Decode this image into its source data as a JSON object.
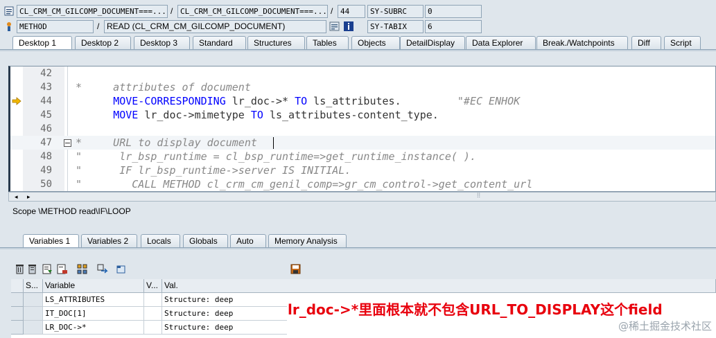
{
  "header": {
    "program_field": "CL_CRM_CM_GILCOMP_DOCUMENT===...",
    "include_field": "CL_CRM_CM_GILCOMP_DOCUMENT===...",
    "line_number": "44",
    "subrc_label": "SY-SUBRC",
    "subrc_value": "0",
    "event_type": "METHOD",
    "event_name": "READ (CL_CRM_CM_GILCOMP_DOCUMENT)",
    "tabix_label": "SY-TABIX",
    "tabix_value": "6",
    "separator": "/"
  },
  "tabs": [
    "Desktop 1",
    "Desktop 2",
    "Desktop 3",
    "Standard",
    "Structures",
    "Tables",
    "Objects",
    "DetailDisplay",
    "Data Explorer",
    "Break./Watchpoints",
    "Diff",
    "Script"
  ],
  "editor": {
    "lines": [
      {
        "num": "42",
        "segments": []
      },
      {
        "num": "43",
        "segments": [
          {
            "t": "*     attributes of document",
            "c": "cm"
          }
        ]
      },
      {
        "num": "44",
        "segments": [
          {
            "t": "      ",
            "c": ""
          },
          {
            "t": "MOVE-CORRESPONDING",
            "c": "kw"
          },
          {
            "t": " lr_doc->* ",
            "c": ""
          },
          {
            "t": "TO",
            "c": "kw"
          },
          {
            "t": " ls_attributes.         ",
            "c": ""
          },
          {
            "t": "\"#EC ENHOK",
            "c": "cm"
          }
        ]
      },
      {
        "num": "45",
        "segments": [
          {
            "t": "      ",
            "c": ""
          },
          {
            "t": "MOVE",
            "c": "kw"
          },
          {
            "t": " lr_doc->mimetype ",
            "c": ""
          },
          {
            "t": "TO",
            "c": "kw"
          },
          {
            "t": " ls_attributes-content_type.",
            "c": ""
          }
        ]
      },
      {
        "num": "46",
        "segments": []
      },
      {
        "num": "47",
        "segments": [
          {
            "t": "*     URL to display document",
            "c": "cm"
          }
        ]
      },
      {
        "num": "48",
        "segments": [
          {
            "t": "\"      lr_bsp_runtime = cl_bsp_runtime=>get_runtime_instance( ).",
            "c": "cm"
          }
        ]
      },
      {
        "num": "49",
        "segments": [
          {
            "t": "\"      IF lr_bsp_runtime->server IS INITIAL.",
            "c": "cm"
          }
        ]
      },
      {
        "num": "50",
        "segments": [
          {
            "t": "\"        CALL METHOD cl_crm_cm_genil_comp=>gr_cm_control->get_content_url",
            "c": "cm"
          }
        ]
      }
    ]
  },
  "scope_text": "Scope \\METHOD read\\IF\\LOOP",
  "var_tabs": [
    "Variables 1",
    "Variables 2",
    "Locals",
    "Globals",
    "Auto",
    "Memory Analysis"
  ],
  "grid": {
    "headers": [
      "S...",
      "Variable",
      "V...",
      "Val."
    ],
    "rows": [
      {
        "variable": "LS_ATTRIBUTES",
        "value": "Structure: deep"
      },
      {
        "variable": "IT_DOC[1]",
        "value": "Structure: deep"
      },
      {
        "variable": "LR_DOC->*",
        "value": "Structure: deep"
      }
    ]
  },
  "annotation": "lr_doc->*里面根本就不包含URL_TO_DISPLAY这个field",
  "watermark": "@稀土掘金技术社区",
  "colors": {
    "keyword": "#0000ff",
    "comment": "#888888",
    "annotation": "#e8000d"
  }
}
